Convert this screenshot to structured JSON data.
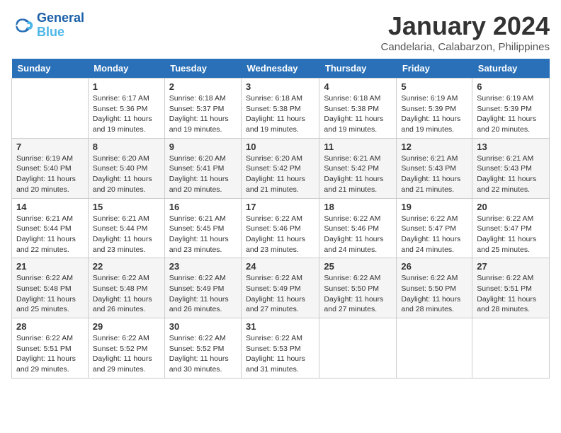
{
  "logo": {
    "line1": "General",
    "line2": "Blue"
  },
  "title": "January 2024",
  "subtitle": "Candelaria, Calabarzon, Philippines",
  "days_header": [
    "Sunday",
    "Monday",
    "Tuesday",
    "Wednesday",
    "Thursday",
    "Friday",
    "Saturday"
  ],
  "weeks": [
    [
      {
        "num": "",
        "info": ""
      },
      {
        "num": "1",
        "info": "Sunrise: 6:17 AM\nSunset: 5:36 PM\nDaylight: 11 hours\nand 19 minutes."
      },
      {
        "num": "2",
        "info": "Sunrise: 6:18 AM\nSunset: 5:37 PM\nDaylight: 11 hours\nand 19 minutes."
      },
      {
        "num": "3",
        "info": "Sunrise: 6:18 AM\nSunset: 5:38 PM\nDaylight: 11 hours\nand 19 minutes."
      },
      {
        "num": "4",
        "info": "Sunrise: 6:18 AM\nSunset: 5:38 PM\nDaylight: 11 hours\nand 19 minutes."
      },
      {
        "num": "5",
        "info": "Sunrise: 6:19 AM\nSunset: 5:39 PM\nDaylight: 11 hours\nand 19 minutes."
      },
      {
        "num": "6",
        "info": "Sunrise: 6:19 AM\nSunset: 5:39 PM\nDaylight: 11 hours\nand 20 minutes."
      }
    ],
    [
      {
        "num": "7",
        "info": "Sunrise: 6:19 AM\nSunset: 5:40 PM\nDaylight: 11 hours\nand 20 minutes."
      },
      {
        "num": "8",
        "info": "Sunrise: 6:20 AM\nSunset: 5:40 PM\nDaylight: 11 hours\nand 20 minutes."
      },
      {
        "num": "9",
        "info": "Sunrise: 6:20 AM\nSunset: 5:41 PM\nDaylight: 11 hours\nand 20 minutes."
      },
      {
        "num": "10",
        "info": "Sunrise: 6:20 AM\nSunset: 5:42 PM\nDaylight: 11 hours\nand 21 minutes."
      },
      {
        "num": "11",
        "info": "Sunrise: 6:21 AM\nSunset: 5:42 PM\nDaylight: 11 hours\nand 21 minutes."
      },
      {
        "num": "12",
        "info": "Sunrise: 6:21 AM\nSunset: 5:43 PM\nDaylight: 11 hours\nand 21 minutes."
      },
      {
        "num": "13",
        "info": "Sunrise: 6:21 AM\nSunset: 5:43 PM\nDaylight: 11 hours\nand 22 minutes."
      }
    ],
    [
      {
        "num": "14",
        "info": "Sunrise: 6:21 AM\nSunset: 5:44 PM\nDaylight: 11 hours\nand 22 minutes."
      },
      {
        "num": "15",
        "info": "Sunrise: 6:21 AM\nSunset: 5:44 PM\nDaylight: 11 hours\nand 23 minutes."
      },
      {
        "num": "16",
        "info": "Sunrise: 6:21 AM\nSunset: 5:45 PM\nDaylight: 11 hours\nand 23 minutes."
      },
      {
        "num": "17",
        "info": "Sunrise: 6:22 AM\nSunset: 5:46 PM\nDaylight: 11 hours\nand 23 minutes."
      },
      {
        "num": "18",
        "info": "Sunrise: 6:22 AM\nSunset: 5:46 PM\nDaylight: 11 hours\nand 24 minutes."
      },
      {
        "num": "19",
        "info": "Sunrise: 6:22 AM\nSunset: 5:47 PM\nDaylight: 11 hours\nand 24 minutes."
      },
      {
        "num": "20",
        "info": "Sunrise: 6:22 AM\nSunset: 5:47 PM\nDaylight: 11 hours\nand 25 minutes."
      }
    ],
    [
      {
        "num": "21",
        "info": "Sunrise: 6:22 AM\nSunset: 5:48 PM\nDaylight: 11 hours\nand 25 minutes."
      },
      {
        "num": "22",
        "info": "Sunrise: 6:22 AM\nSunset: 5:48 PM\nDaylight: 11 hours\nand 26 minutes."
      },
      {
        "num": "23",
        "info": "Sunrise: 6:22 AM\nSunset: 5:49 PM\nDaylight: 11 hours\nand 26 minutes."
      },
      {
        "num": "24",
        "info": "Sunrise: 6:22 AM\nSunset: 5:49 PM\nDaylight: 11 hours\nand 27 minutes."
      },
      {
        "num": "25",
        "info": "Sunrise: 6:22 AM\nSunset: 5:50 PM\nDaylight: 11 hours\nand 27 minutes."
      },
      {
        "num": "26",
        "info": "Sunrise: 6:22 AM\nSunset: 5:50 PM\nDaylight: 11 hours\nand 28 minutes."
      },
      {
        "num": "27",
        "info": "Sunrise: 6:22 AM\nSunset: 5:51 PM\nDaylight: 11 hours\nand 28 minutes."
      }
    ],
    [
      {
        "num": "28",
        "info": "Sunrise: 6:22 AM\nSunset: 5:51 PM\nDaylight: 11 hours\nand 29 minutes."
      },
      {
        "num": "29",
        "info": "Sunrise: 6:22 AM\nSunset: 5:52 PM\nDaylight: 11 hours\nand 29 minutes."
      },
      {
        "num": "30",
        "info": "Sunrise: 6:22 AM\nSunset: 5:52 PM\nDaylight: 11 hours\nand 30 minutes."
      },
      {
        "num": "31",
        "info": "Sunrise: 6:22 AM\nSunset: 5:53 PM\nDaylight: 11 hours\nand 31 minutes."
      },
      {
        "num": "",
        "info": ""
      },
      {
        "num": "",
        "info": ""
      },
      {
        "num": "",
        "info": ""
      }
    ]
  ]
}
